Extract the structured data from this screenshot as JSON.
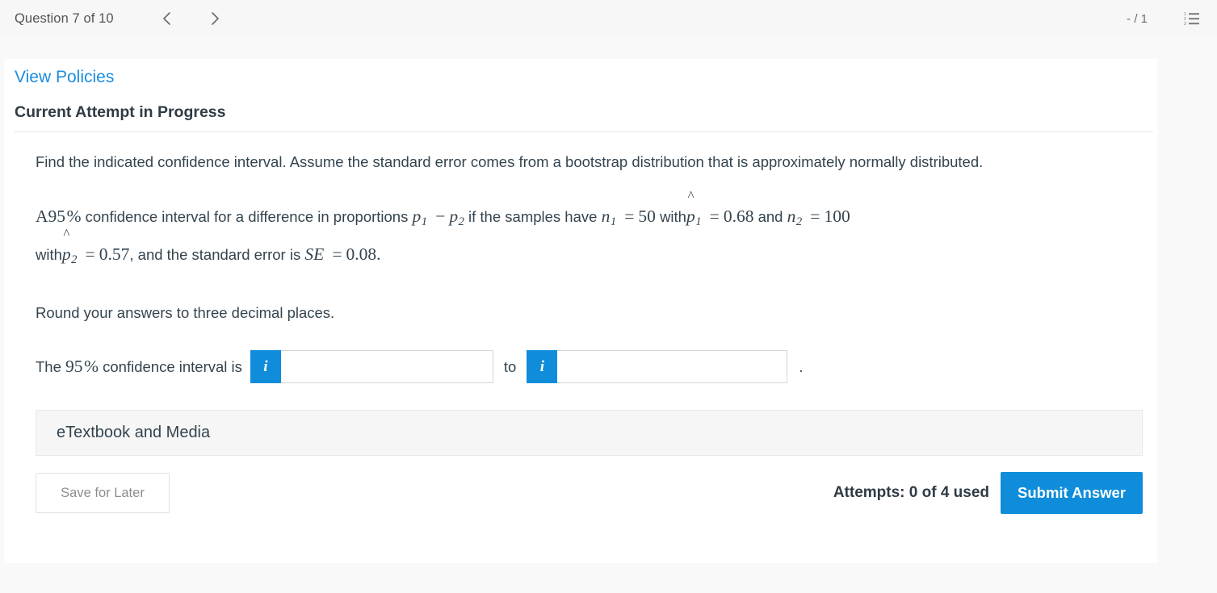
{
  "topbar": {
    "question_counter": "Question 7 of 10",
    "prev_label": "‹",
    "next_label": "›",
    "score": "- / 1",
    "list_icon_name": "numbered-list-icon"
  },
  "card": {
    "view_policies": "View Policies",
    "attempt_status": "Current Attempt in Progress"
  },
  "question": {
    "intro": "Find the indicated confidence interval. Assume the standard error comes from a bootstrap distribution that is approximately normally distributed.",
    "statement": {
      "lead": "A",
      "confidence_level": "95",
      "percent": "%",
      "mid1": "confidence interval for a difference in proportions",
      "p1": "p",
      "p1_sub": "1",
      "minus": "−",
      "p2": "p",
      "p2_sub": "2",
      "mid2": "if the samples have",
      "n1": "n",
      "n1_sub": "1",
      "eq": "=",
      "n1_val": "50",
      "with1": "with",
      "phat1": "p",
      "phat1_sub": "1",
      "hat": "^",
      "phat1_val": "0.68",
      "and": "and",
      "n2": "n",
      "n2_sub": "2",
      "n2_val": "100",
      "with2": "with",
      "phat2": "p",
      "phat2_sub": "2",
      "phat2_val": "0.57",
      "comma_tail": ", and the standard error is",
      "se": "SE",
      "se_val": "0.08",
      "period": "."
    },
    "rounding_note": "Round your answers to three decimal places."
  },
  "answer": {
    "prefix": "The",
    "level": "95",
    "percent": "%",
    "suffix": "confidence interval is",
    "info_glyph": "i",
    "lower_value": "",
    "lower_placeholder": "",
    "to_word": "to",
    "upper_value": "",
    "upper_placeholder": "",
    "trailing_period": "."
  },
  "etextbook": {
    "label": "eTextbook and Media"
  },
  "footer": {
    "save_for_later": "Save for Later",
    "attempts": "Attempts: 0 of 4 used",
    "submit": "Submit Answer"
  },
  "colors": {
    "accent_blue": "#0f8ddb",
    "link_blue": "#1c8ce0",
    "text_dark": "#34444f",
    "page_bg": "#f9f9f9",
    "topbar_bg": "#f7f7f7"
  }
}
